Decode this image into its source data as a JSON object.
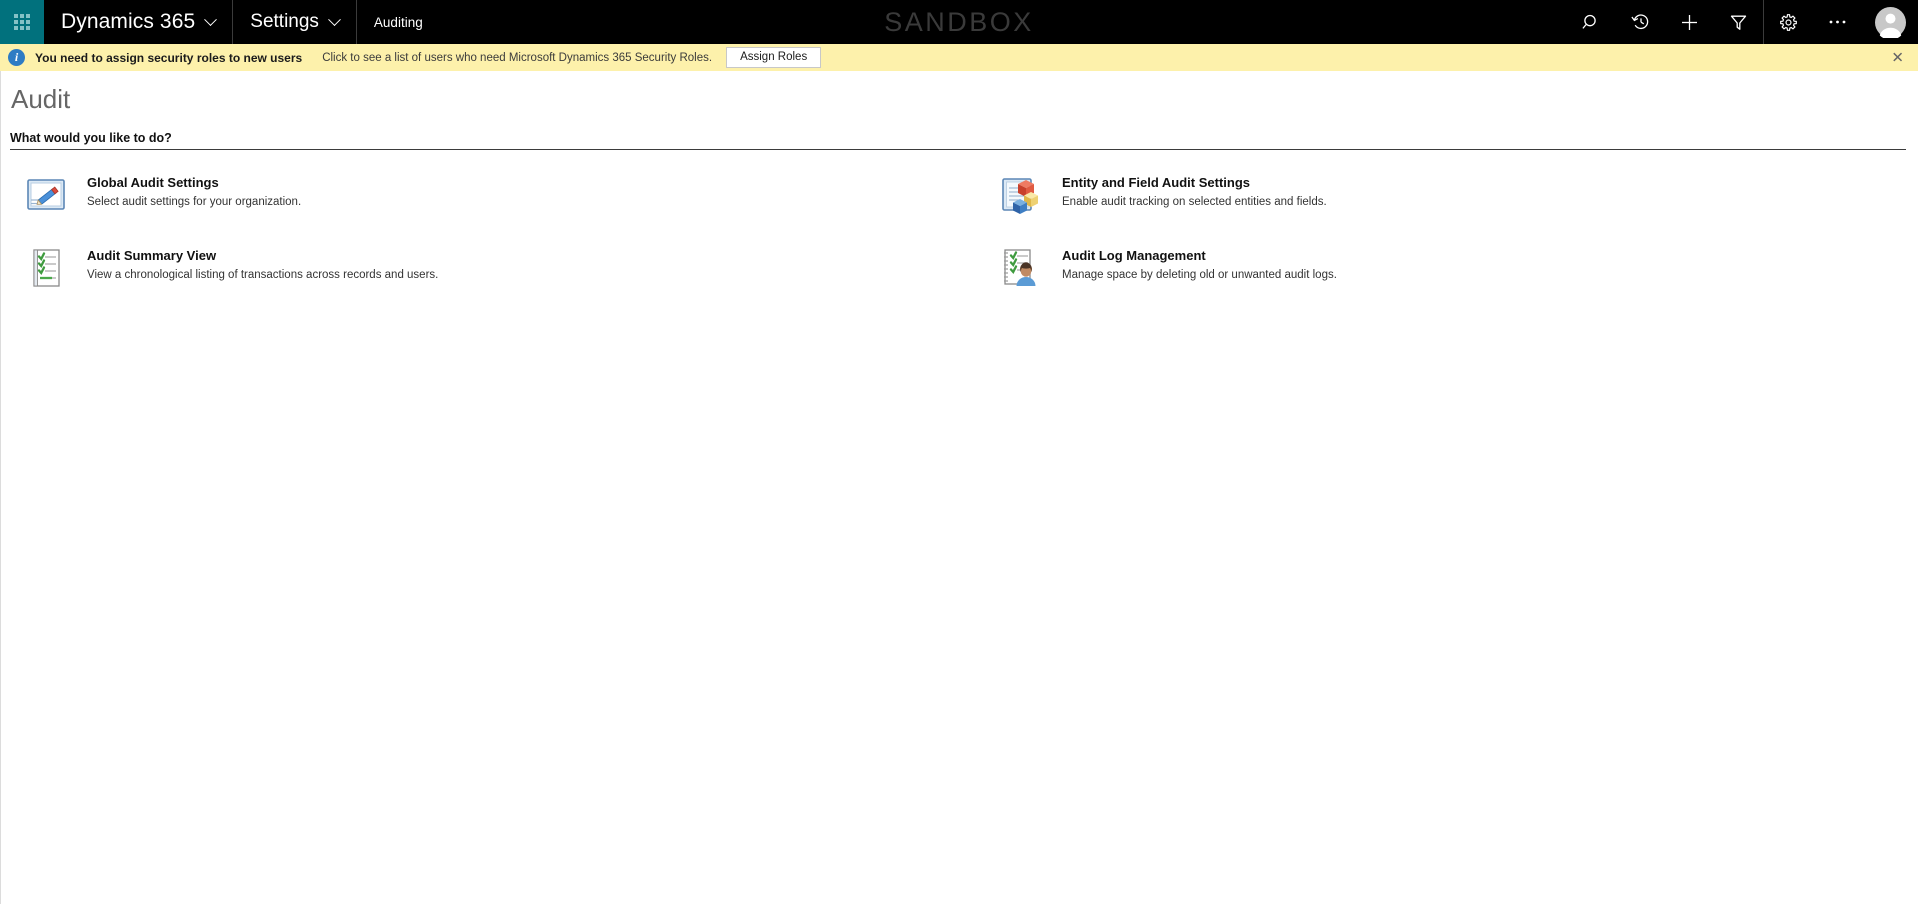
{
  "topnav": {
    "waffle_label": "App launcher",
    "brand": "Dynamics 365",
    "area": "Settings",
    "subarea": "Auditing",
    "watermark": "SANDBOX",
    "icons": [
      {
        "name": "search-icon",
        "title": "Search"
      },
      {
        "name": "history-icon",
        "title": "Recently viewed"
      },
      {
        "name": "plus-icon",
        "title": "Quick create"
      },
      {
        "name": "filter-icon",
        "title": "Filter"
      },
      {
        "name": "gear-icon",
        "title": "Settings"
      },
      {
        "name": "ellipsis-icon",
        "title": "More"
      },
      {
        "name": "avatar-icon",
        "title": "User account"
      }
    ]
  },
  "notification": {
    "icon": "info-icon",
    "headline": "You need to assign security roles to new users",
    "detail": "Click to see a list of users who need Microsoft Dynamics 365 Security Roles.",
    "action_label": "Assign Roles",
    "close_label": "✕"
  },
  "page": {
    "title": "Audit",
    "section_heading": "What would you like to do?"
  },
  "tiles": [
    {
      "icon": "global-audit-settings-icon",
      "title": "Global Audit Settings",
      "description": "Select audit settings for your organization."
    },
    {
      "icon": "entity-field-audit-settings-icon",
      "title": "Entity and Field Audit Settings",
      "description": "Enable audit tracking on selected entities and fields."
    },
    {
      "icon": "audit-summary-view-icon",
      "title": "Audit Summary View",
      "description": "View a chronological listing of transactions across records and users."
    },
    {
      "icon": "audit-log-management-icon",
      "title": "Audit Log Management",
      "description": "Manage space by deleting old or unwanted audit logs."
    }
  ],
  "colors": {
    "nav_background": "#000000",
    "waffle_teal": "#01717d",
    "notification_yellow": "#fdf1ab",
    "info_blue": "#2e7cc4",
    "title_grey": "#666666",
    "watermark_grey": "#3a3a3a"
  }
}
